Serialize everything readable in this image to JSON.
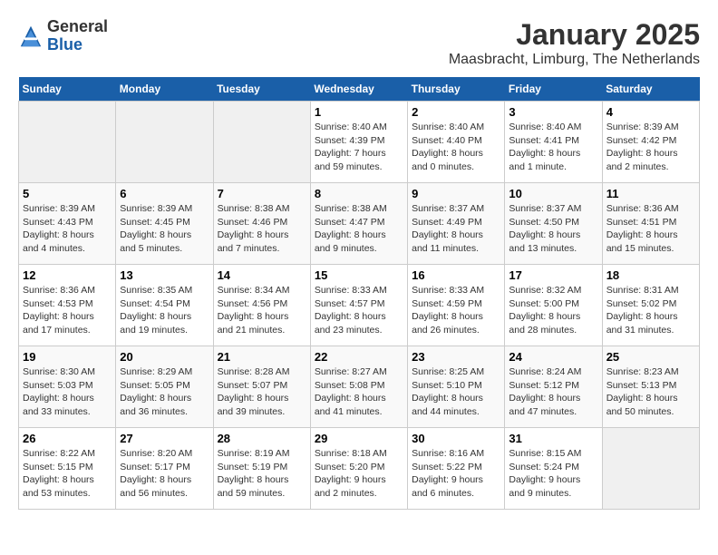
{
  "header": {
    "logo_line1": "General",
    "logo_line2": "Blue",
    "month": "January 2025",
    "location": "Maasbracht, Limburg, The Netherlands"
  },
  "weekdays": [
    "Sunday",
    "Monday",
    "Tuesday",
    "Wednesday",
    "Thursday",
    "Friday",
    "Saturday"
  ],
  "weeks": [
    [
      {
        "day": "",
        "info": ""
      },
      {
        "day": "",
        "info": ""
      },
      {
        "day": "",
        "info": ""
      },
      {
        "day": "1",
        "info": "Sunrise: 8:40 AM\nSunset: 4:39 PM\nDaylight: 7 hours\nand 59 minutes."
      },
      {
        "day": "2",
        "info": "Sunrise: 8:40 AM\nSunset: 4:40 PM\nDaylight: 8 hours\nand 0 minutes."
      },
      {
        "day": "3",
        "info": "Sunrise: 8:40 AM\nSunset: 4:41 PM\nDaylight: 8 hours\nand 1 minute."
      },
      {
        "day": "4",
        "info": "Sunrise: 8:39 AM\nSunset: 4:42 PM\nDaylight: 8 hours\nand 2 minutes."
      }
    ],
    [
      {
        "day": "5",
        "info": "Sunrise: 8:39 AM\nSunset: 4:43 PM\nDaylight: 8 hours\nand 4 minutes."
      },
      {
        "day": "6",
        "info": "Sunrise: 8:39 AM\nSunset: 4:45 PM\nDaylight: 8 hours\nand 5 minutes."
      },
      {
        "day": "7",
        "info": "Sunrise: 8:38 AM\nSunset: 4:46 PM\nDaylight: 8 hours\nand 7 minutes."
      },
      {
        "day": "8",
        "info": "Sunrise: 8:38 AM\nSunset: 4:47 PM\nDaylight: 8 hours\nand 9 minutes."
      },
      {
        "day": "9",
        "info": "Sunrise: 8:37 AM\nSunset: 4:49 PM\nDaylight: 8 hours\nand 11 minutes."
      },
      {
        "day": "10",
        "info": "Sunrise: 8:37 AM\nSunset: 4:50 PM\nDaylight: 8 hours\nand 13 minutes."
      },
      {
        "day": "11",
        "info": "Sunrise: 8:36 AM\nSunset: 4:51 PM\nDaylight: 8 hours\nand 15 minutes."
      }
    ],
    [
      {
        "day": "12",
        "info": "Sunrise: 8:36 AM\nSunset: 4:53 PM\nDaylight: 8 hours\nand 17 minutes."
      },
      {
        "day": "13",
        "info": "Sunrise: 8:35 AM\nSunset: 4:54 PM\nDaylight: 8 hours\nand 19 minutes."
      },
      {
        "day": "14",
        "info": "Sunrise: 8:34 AM\nSunset: 4:56 PM\nDaylight: 8 hours\nand 21 minutes."
      },
      {
        "day": "15",
        "info": "Sunrise: 8:33 AM\nSunset: 4:57 PM\nDaylight: 8 hours\nand 23 minutes."
      },
      {
        "day": "16",
        "info": "Sunrise: 8:33 AM\nSunset: 4:59 PM\nDaylight: 8 hours\nand 26 minutes."
      },
      {
        "day": "17",
        "info": "Sunrise: 8:32 AM\nSunset: 5:00 PM\nDaylight: 8 hours\nand 28 minutes."
      },
      {
        "day": "18",
        "info": "Sunrise: 8:31 AM\nSunset: 5:02 PM\nDaylight: 8 hours\nand 31 minutes."
      }
    ],
    [
      {
        "day": "19",
        "info": "Sunrise: 8:30 AM\nSunset: 5:03 PM\nDaylight: 8 hours\nand 33 minutes."
      },
      {
        "day": "20",
        "info": "Sunrise: 8:29 AM\nSunset: 5:05 PM\nDaylight: 8 hours\nand 36 minutes."
      },
      {
        "day": "21",
        "info": "Sunrise: 8:28 AM\nSunset: 5:07 PM\nDaylight: 8 hours\nand 39 minutes."
      },
      {
        "day": "22",
        "info": "Sunrise: 8:27 AM\nSunset: 5:08 PM\nDaylight: 8 hours\nand 41 minutes."
      },
      {
        "day": "23",
        "info": "Sunrise: 8:25 AM\nSunset: 5:10 PM\nDaylight: 8 hours\nand 44 minutes."
      },
      {
        "day": "24",
        "info": "Sunrise: 8:24 AM\nSunset: 5:12 PM\nDaylight: 8 hours\nand 47 minutes."
      },
      {
        "day": "25",
        "info": "Sunrise: 8:23 AM\nSunset: 5:13 PM\nDaylight: 8 hours\nand 50 minutes."
      }
    ],
    [
      {
        "day": "26",
        "info": "Sunrise: 8:22 AM\nSunset: 5:15 PM\nDaylight: 8 hours\nand 53 minutes."
      },
      {
        "day": "27",
        "info": "Sunrise: 8:20 AM\nSunset: 5:17 PM\nDaylight: 8 hours\nand 56 minutes."
      },
      {
        "day": "28",
        "info": "Sunrise: 8:19 AM\nSunset: 5:19 PM\nDaylight: 8 hours\nand 59 minutes."
      },
      {
        "day": "29",
        "info": "Sunrise: 8:18 AM\nSunset: 5:20 PM\nDaylight: 9 hours\nand 2 minutes."
      },
      {
        "day": "30",
        "info": "Sunrise: 8:16 AM\nSunset: 5:22 PM\nDaylight: 9 hours\nand 6 minutes."
      },
      {
        "day": "31",
        "info": "Sunrise: 8:15 AM\nSunset: 5:24 PM\nDaylight: 9 hours\nand 9 minutes."
      },
      {
        "day": "",
        "info": ""
      }
    ]
  ]
}
